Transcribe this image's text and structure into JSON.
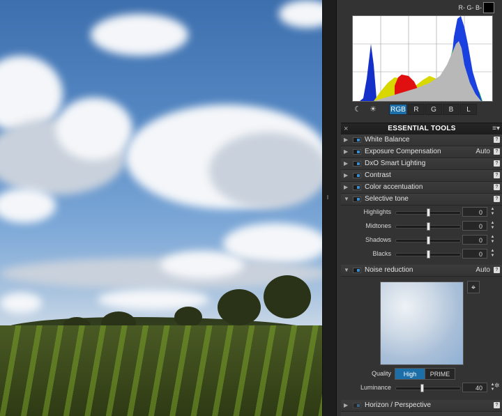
{
  "rgb_readout": "R- G- B-",
  "histogram": {
    "channels": [
      "RGB",
      "R",
      "G",
      "B",
      "L"
    ],
    "active_channel": "RGB",
    "icons": [
      "moon-icon",
      "sun-icon"
    ]
  },
  "essential_tools": {
    "close_icon": "×",
    "title": "ESSENTIAL TOOLS",
    "menu_icon": "≡▾"
  },
  "tools": [
    {
      "label": "White Balance",
      "value": ""
    },
    {
      "label": "Exposure Compensation",
      "value": "Auto"
    },
    {
      "label": "DxO Smart Lighting",
      "value": ""
    },
    {
      "label": "Contrast",
      "value": ""
    },
    {
      "label": "Color accentuation",
      "value": ""
    },
    {
      "label": "Selective tone",
      "value": ""
    }
  ],
  "selective_tone": [
    {
      "label": "Highlights",
      "value": "0",
      "level": 0.5
    },
    {
      "label": "Midtones",
      "value": "0",
      "level": 0.5
    },
    {
      "label": "Shadows",
      "value": "0",
      "level": 0.5
    },
    {
      "label": "Blacks",
      "value": "0",
      "level": 0.5
    }
  ],
  "noise_reduction": {
    "label": "Noise reduction",
    "value": "Auto",
    "quality_label": "Quality",
    "quality_options": [
      "High",
      "PRIME"
    ],
    "quality_selected": "High",
    "luminance_label": "Luminance",
    "luminance_value": "40",
    "luminance_level": 0.4
  },
  "horizon": {
    "label": "Horizon / Perspective"
  },
  "colors": {
    "accent": "#1c6ea8",
    "panel": "#333333"
  }
}
